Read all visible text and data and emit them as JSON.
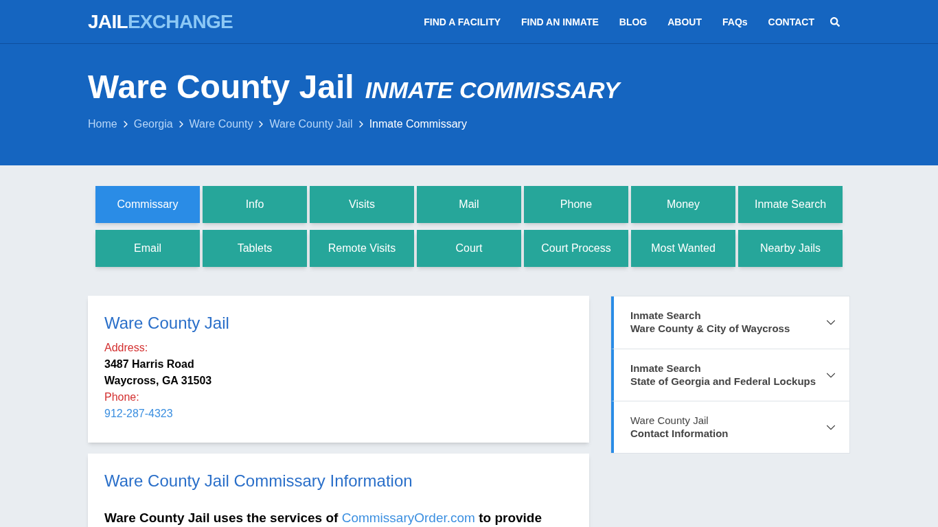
{
  "logo": {
    "part_1": "JAIL",
    "part_2": "EXCHANGE"
  },
  "nav": [
    "FIND A FACILITY",
    "FIND AN INMATE",
    "BLOG",
    "ABOUT",
    "FAQs",
    "CONTACT"
  ],
  "hero": {
    "title": "Ware County Jail",
    "subtitle": "INMATE COMMISSARY",
    "breadcrumbs": [
      {
        "label": "Home",
        "current": false
      },
      {
        "label": "Georgia",
        "current": false
      },
      {
        "label": "Ware County",
        "current": false
      },
      {
        "label": "Ware County Jail",
        "current": false
      },
      {
        "label": "Inmate Commissary",
        "current": true
      }
    ]
  },
  "tabs": [
    {
      "label": "Commissary",
      "selected": true
    },
    {
      "label": "Info",
      "selected": false
    },
    {
      "label": "Visits",
      "selected": false
    },
    {
      "label": "Mail",
      "selected": false
    },
    {
      "label": "Phone",
      "selected": false
    },
    {
      "label": "Money",
      "selected": false
    },
    {
      "label": "Inmate Search",
      "selected": false
    },
    {
      "label": "Email",
      "selected": false
    },
    {
      "label": "Tablets",
      "selected": false
    },
    {
      "label": "Remote Visits",
      "selected": false
    },
    {
      "label": "Court",
      "selected": false
    },
    {
      "label": "Court Process",
      "selected": false
    },
    {
      "label": "Most Wanted",
      "selected": false
    },
    {
      "label": "Nearby Jails",
      "selected": false
    }
  ],
  "facility_card": {
    "title": "Ware County Jail",
    "address_label": "Address:",
    "address_lines": [
      "3487 Harris Road",
      "Waycross, GA 31503"
    ],
    "phone_label": "Phone:",
    "phone": "912-287-4323"
  },
  "info_card": {
    "title": "Ware County Jail Commissary Information",
    "text_before": "Ware County Jail uses the services of ",
    "link": "CommissaryOrder.com",
    "text_after": " to provide"
  },
  "sidebar": [
    {
      "title": "Inmate Search",
      "title_bold": true,
      "subtitle": "Ware County & City of Waycross",
      "expanded": false
    },
    {
      "title": "Inmate Search",
      "title_bold": true,
      "subtitle": "State of Georgia and Federal Lockups",
      "expanded": false
    },
    {
      "title": "Ware County Jail",
      "title_bold": false,
      "subtitle": "Contact Information",
      "expanded": false
    }
  ]
}
